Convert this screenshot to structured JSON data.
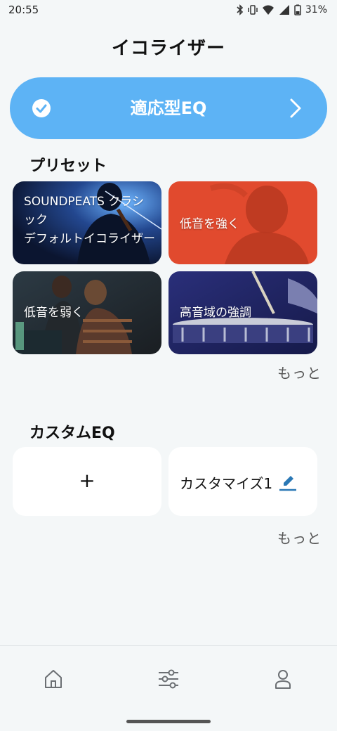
{
  "status_bar": {
    "time": "20:55",
    "battery": "31%",
    "icons": [
      "bluetooth-icon",
      "vibrate-icon",
      "wifi-icon",
      "signal-icon",
      "battery-icon"
    ]
  },
  "header": {
    "title": "イコライザー"
  },
  "adaptive": {
    "label": "適応型EQ",
    "color": "#5db3f5"
  },
  "presets": {
    "title": "プリセット",
    "items": [
      {
        "line1": "SOUNDPEATS クラシ",
        "line2": "ック",
        "line3": "デフォルトイコライザー"
      },
      {
        "label": "低音を強く",
        "color": "#e14a2e"
      },
      {
        "label": "低音を弱く"
      },
      {
        "label": "高音域の強調"
      }
    ],
    "more": "もっと"
  },
  "custom_eq": {
    "title": "カスタムEQ",
    "add_symbol": "+",
    "items": [
      {
        "name": "カスタマイズ1"
      }
    ],
    "more": "もっと"
  },
  "nav": {
    "items": [
      "home-icon",
      "equalizer-icon",
      "profile-icon"
    ]
  }
}
